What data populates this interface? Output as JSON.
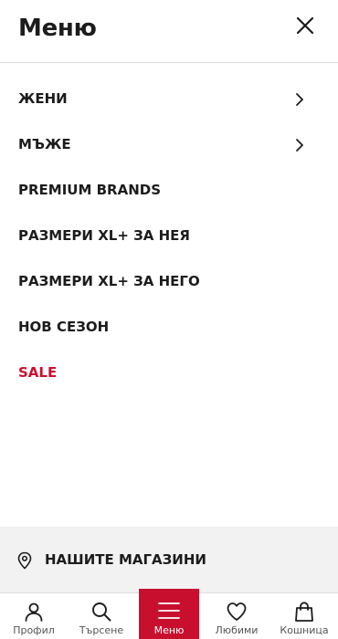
{
  "header": {
    "title": "Меню",
    "close_icon": "close-icon"
  },
  "menu": {
    "items": [
      {
        "label": "ЖЕНИ",
        "has_submenu": true
      },
      {
        "label": "МЪЖЕ",
        "has_submenu": true
      },
      {
        "label": "PREMIUM BRANDS",
        "has_submenu": false
      },
      {
        "label": "РАЗМЕРИ XL+ ЗА НЕЯ",
        "has_submenu": false
      },
      {
        "label": "РАЗМЕРИ XL+ ЗА НЕГО",
        "has_submenu": false
      },
      {
        "label": "НОВ СЕЗОН",
        "has_submenu": false
      },
      {
        "label": "SALE",
        "has_submenu": false,
        "color": "#c8102e"
      }
    ]
  },
  "stores": {
    "label": "НАШИТЕ МАГАЗИНИ",
    "icon": "location-pin-icon"
  },
  "tabbar": {
    "tabs": [
      {
        "label": "Профил",
        "icon": "user-icon"
      },
      {
        "label": "Търсене",
        "icon": "search-icon"
      },
      {
        "label": "Меню",
        "icon": "hamburger-menu-icon",
        "active": true
      },
      {
        "label": "Любими",
        "icon": "heart-icon"
      },
      {
        "label": "Кошница",
        "icon": "shopping-bag-icon"
      }
    ]
  },
  "colors": {
    "accent": "#c8102e",
    "text": "#1c1c1c",
    "footer_bg": "#f2f2f2",
    "divider": "#dcdcdc"
  }
}
